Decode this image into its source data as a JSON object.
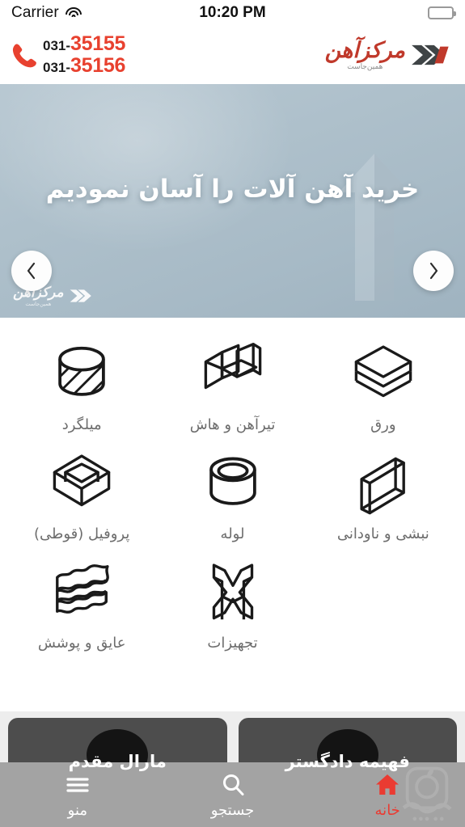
{
  "status_bar": {
    "carrier": "Carrier",
    "time": "10:20 PM",
    "wifi_icon": "wifi-icon",
    "battery_icon": "battery-full-icon"
  },
  "header": {
    "phone_icon": "phone-icon",
    "phones": [
      {
        "prefix": "031-",
        "number": "35155"
      },
      {
        "prefix": "031-",
        "number": "35156"
      }
    ],
    "brand": {
      "name": "مرکزآهن",
      "tagline": "همین‌جاست",
      "mark_icon": "chevrons-logo-icon"
    },
    "phone_number_color": "#e8412f"
  },
  "banner": {
    "caption": "خرید آهن آلات را آسان نمودیم",
    "prev_label": "‹",
    "next_label": "›",
    "prev_icon": "chevron-left-icon",
    "next_icon": "chevron-right-icon",
    "watermark": {
      "name": "مرکزآهن",
      "tagline": "همین‌جاست",
      "mark_icon": "chevrons-logo-icon"
    },
    "background_color": "#aec0cb"
  },
  "categories": [
    {
      "label": "ورق",
      "icon": "stacked-sheets-icon"
    },
    {
      "label": "تیرآهن و هاش",
      "icon": "i-beam-icon"
    },
    {
      "label": "میلگرد",
      "icon": "hatched-cylinder-icon"
    },
    {
      "label": "نبشی و ناودانی",
      "icon": "angle-channel-icon"
    },
    {
      "label": "لوله",
      "icon": "pipe-icon"
    },
    {
      "label": "پروفیل (قوطی)",
      "icon": "box-profile-icon"
    },
    {
      "label": "",
      "icon": ""
    },
    {
      "label": "تجهیزات",
      "icon": "equipment-icon"
    },
    {
      "label": "عایق و پوشش",
      "icon": "insulation-layers-icon"
    }
  ],
  "article_cards": [
    {
      "title": "فهیمه دادگستر"
    },
    {
      "title": "مارال مقدم"
    }
  ],
  "tabbar": {
    "items": [
      {
        "label": "خانه",
        "icon": "home-icon",
        "active": true
      },
      {
        "label": "جستجو",
        "icon": "search-icon",
        "active": false
      },
      {
        "label": "منو",
        "icon": "hamburger-menu-icon",
        "active": false
      }
    ],
    "active_color": "#ea3b32",
    "background_color": "#a3a3a3"
  },
  "watermark": {
    "name": "store-watermark-icon"
  }
}
